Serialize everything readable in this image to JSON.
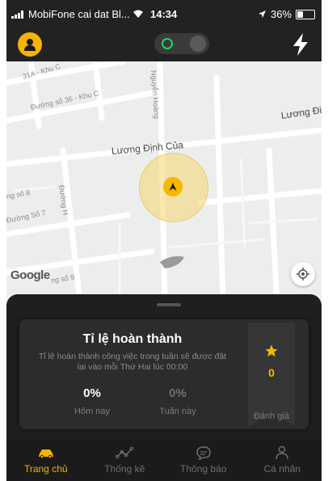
{
  "status_bar": {
    "carrier": "MobiFone cai dat Bl...",
    "time": "14:34",
    "battery": "36%",
    "battery_level": 0.36
  },
  "map": {
    "streets": {
      "s1": "31A - Khu C",
      "s2": "Đường số 36 - Khu C",
      "s3": "Nguyễn Hoàng",
      "s4": "Lương Đi",
      "s5": "Lương Định Của",
      "s6": "ng số 8",
      "s7": "Đường H",
      "s8": "Đường Số 7",
      "s9": "ng số 9"
    },
    "google_logo": "Google"
  },
  "card": {
    "title": "Tỉ lệ hoàn thành",
    "desc": "Tỉ lệ hoàn thành công việc trong tuần sẽ được đặt lại vào mỗi Thứ Hai lúc 00:00",
    "today": {
      "value": "0%",
      "label": "Hôm nay"
    },
    "week": {
      "value": "0%",
      "label": "Tuần này"
    },
    "rating": {
      "value": "0",
      "label": "Đánh giá"
    }
  },
  "nav": {
    "items": [
      {
        "label": "Trang chủ",
        "icon": "car-icon",
        "active": true
      },
      {
        "label": "Thống kê",
        "icon": "stats-icon",
        "active": false
      },
      {
        "label": "Thông báo",
        "icon": "chat-icon",
        "active": false
      },
      {
        "label": "Cá nhân",
        "icon": "person-icon",
        "active": false
      }
    ]
  },
  "colors": {
    "accent": "#f5b400",
    "online_indicator": "#1ed760",
    "background": "#1b1b1b"
  }
}
